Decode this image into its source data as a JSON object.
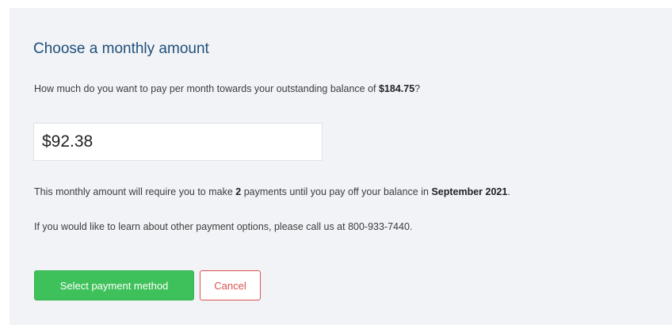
{
  "heading": "Choose a monthly amount",
  "question": {
    "prefix": "How much do you want to pay per month towards your outstanding balance of ",
    "balance": "$184.75",
    "suffix": "?"
  },
  "amount_input": {
    "value": "$92.38"
  },
  "requirement": {
    "prefix": "This monthly amount will require you to make ",
    "payment_count": "2",
    "middle": " payments until you pay off your balance in ",
    "payoff_date": "September 2021",
    "suffix": "."
  },
  "info_text": "If you would like to learn about other payment options, please call us at 800-933-7440.",
  "buttons": {
    "select_label": "Select payment method",
    "cancel_label": "Cancel"
  },
  "colors": {
    "heading": "#1f4f7a",
    "primary_button": "#3ec15a",
    "cancel_button": "#d9534f",
    "panel_background": "#f2f3f7"
  }
}
